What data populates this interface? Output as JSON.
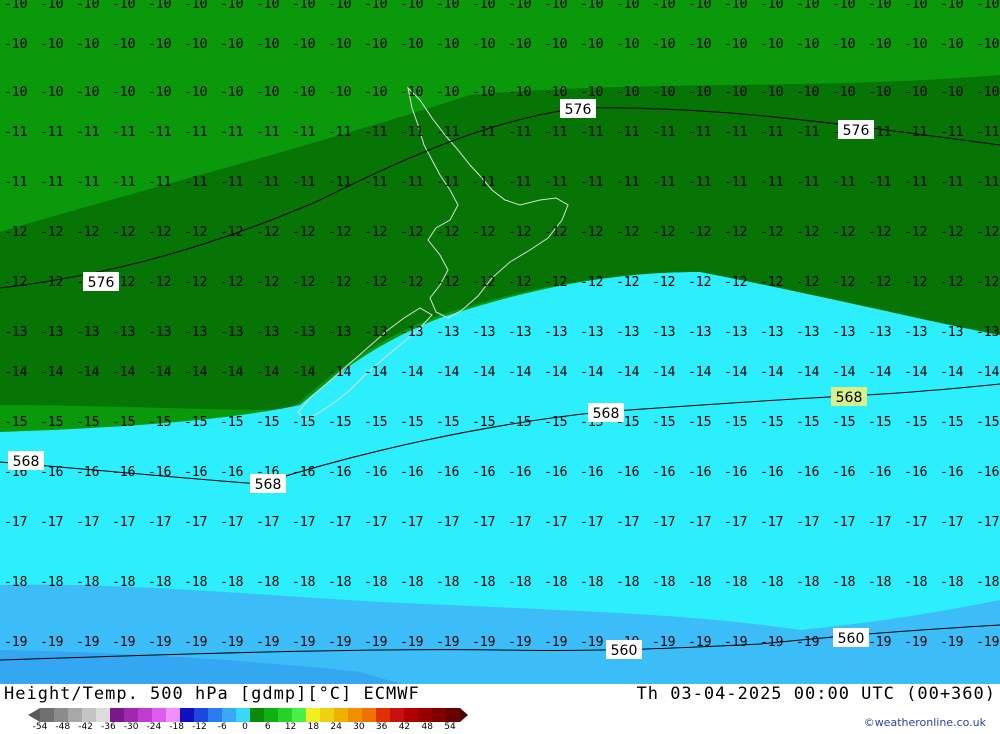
{
  "map": {
    "colors": {
      "zone_m10_m12": "#0a990a",
      "zone_m12_m15": "#067506",
      "zone_m15_m18": "#2ceefc",
      "zone_m18_m20": "#3cbdf8",
      "zone_m20": "#35a6f2",
      "isohypse": "#000000",
      "coast": "#d8e0d8"
    },
    "temp_labels": [
      {
        "row": 0,
        "text": "-10"
      },
      {
        "row": 1,
        "text": "-10"
      },
      {
        "row": 2,
        "text": "-10"
      },
      {
        "row": 3,
        "text": "-11"
      },
      {
        "row": 4,
        "text": "-11"
      },
      {
        "row": 5,
        "text": "-12"
      },
      {
        "row": 6,
        "text": "-12"
      },
      {
        "row": 7,
        "text": "-13"
      },
      {
        "row": 8,
        "text": "-14"
      },
      {
        "row": 9,
        "text": "-15"
      },
      {
        "row": 10,
        "text": "-16"
      },
      {
        "row": 11,
        "text": "-17"
      },
      {
        "row": 12,
        "text": "-18"
      },
      {
        "row": 13,
        "text": "-19"
      }
    ],
    "isohypse_labels": [
      {
        "text": "576"
      },
      {
        "text": "576"
      },
      {
        "text": "576"
      },
      {
        "text": "568"
      },
      {
        "text": "568"
      },
      {
        "text": "568"
      },
      {
        "text": "568"
      },
      {
        "text": "560"
      },
      {
        "text": "560"
      }
    ]
  },
  "footer": {
    "title_left": "Height/Temp. 500 hPa [gdmp][°C] ECMWF",
    "title_right": "Th 03-04-2025 00:00 UTC (00+360)",
    "credit": "©weatheronline.co.uk",
    "legend_ticks": [
      "-54",
      "-48",
      "-42",
      "-36",
      "-30",
      "-24",
      "-18",
      "-12",
      "-6",
      "0",
      "6",
      "12",
      "18",
      "24",
      "30",
      "36",
      "42",
      "48",
      "54"
    ],
    "legend_colors": [
      "#707070",
      "#8c8c8c",
      "#a8a8a8",
      "#c4c4c4",
      "#dcdcdc",
      "#7a1a8a",
      "#9e28b0",
      "#c03cd0",
      "#dc5cf0",
      "#f090ff",
      "#1010c0",
      "#1a48e0",
      "#2a7cf0",
      "#3aa8f8",
      "#38d8fc",
      "#0a8a0a",
      "#10b010",
      "#28d028",
      "#48f048",
      "#f0f020",
      "#f0d010",
      "#f0b000",
      "#f09000",
      "#f07000",
      "#e03000",
      "#c81010",
      "#b00000",
      "#980000",
      "#800000",
      "#680000"
    ]
  }
}
